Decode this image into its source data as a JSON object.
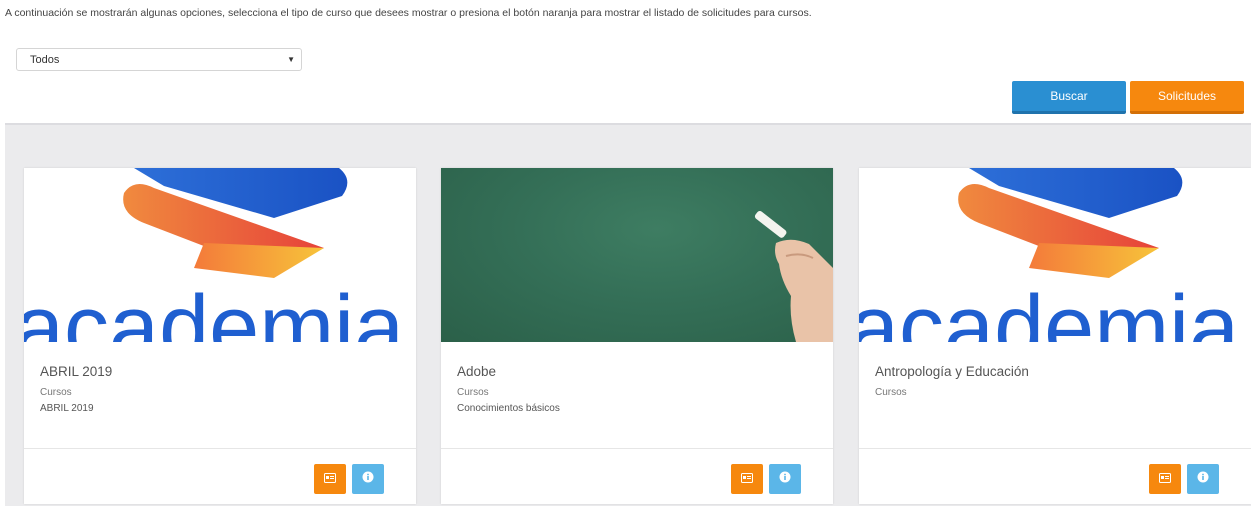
{
  "intro": {
    "text": "A continuación se mostrarán algunas opciones, selecciona el tipo de curso que desees mostrar o presiona el botón naranja para mostrar el listado de solicitudes para cursos."
  },
  "filter": {
    "selected": "Todos"
  },
  "actions": {
    "search_label": "Buscar",
    "requests_label": "Solicitudes"
  },
  "cards": [
    {
      "title": "ABRIL 2019",
      "category": "Cursos",
      "description": "ABRIL 2019",
      "image": "academia-logo",
      "logo_text": "academia"
    },
    {
      "title": "Adobe",
      "category": "Cursos",
      "description": "Conocimientos básicos",
      "image": "chalkboard-photo"
    },
    {
      "title": "Antropología y Educación",
      "category": "Cursos",
      "description": "",
      "image": "academia-logo",
      "logo_text": "academia"
    }
  ],
  "colors": {
    "primary_blue": "#2a8fd2",
    "accent_orange": "#f6880e",
    "info_blue": "#5bb6e8",
    "panel_gray": "#ebebed"
  },
  "icons": {
    "card_action_1": "id-card-icon",
    "card_action_2": "info-circle-icon"
  }
}
